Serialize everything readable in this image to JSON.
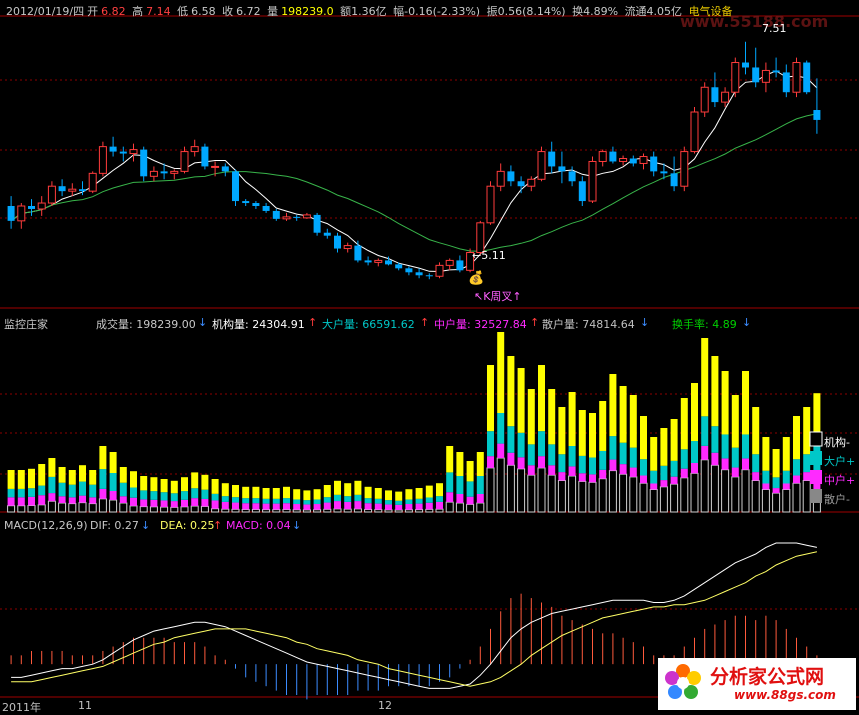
{
  "colors": {
    "up": "#ff3c3c",
    "down": "#00a8ff",
    "ma_short": "#ffffff",
    "ma_long": "#38b44a",
    "inst": "#ffffff",
    "big": "#00c8c8",
    "mid": "#ff2aff",
    "retail": "#ffff00",
    "dif": "#ffffff",
    "dea": "#ffff66",
    "hist_pos": "#ff5a3c",
    "hist_neg": "#3c8cff",
    "grid": "#8b0000"
  },
  "header": {
    "date": "2012/01/19/四",
    "open_label": "开",
    "open": "6.82",
    "high_label": "高",
    "high": "7.14",
    "low_label": "低",
    "low": "6.58",
    "close_label": "收",
    "close": "6.72",
    "vol_label": "量",
    "vol": "198239.0",
    "amount": "额1.36亿",
    "change": "幅-0.16(-2.33%)",
    "amplitude": "振0.56(8.14%)",
    "turnover": "换4.89%",
    "float": "流通4.05亿",
    "sector": "电气设备"
  },
  "price_annotations": {
    "high_mark": "7.51",
    "low_mark": "←5.11",
    "signal": "↖K周叉↑"
  },
  "volume_panel": {
    "title": "监控庄家",
    "vol_label": "成交量: 198239.00",
    "inst_label": "机构量: 24304.91",
    "big_label": "大户量: 66591.62",
    "mid_label": "中户量: 32527.84",
    "retail_label": "散户量: 74814.64",
    "turn_label": "换手率: 4.89",
    "legend": [
      "机构-",
      "大户+",
      "中户+",
      "散户-"
    ]
  },
  "macd_panel": {
    "title": "MACD(12,26,9)",
    "dif": "DIF: 0.27",
    "dea": "DEA: 0.25",
    "macd": "MACD: 0.04"
  },
  "x_axis": {
    "year": "2011年",
    "m1": "11",
    "m2": "12"
  },
  "watermark": {
    "site_ghost": "www.55188.com",
    "brand": "分析家公式网",
    "url": "www.88gs.com"
  },
  "chart_data": [
    {
      "type": "candlestick",
      "name": "price",
      "ohlc": [
        [
          5.85,
          5.95,
          5.62,
          5.7
        ],
        [
          5.7,
          5.88,
          5.62,
          5.85
        ],
        [
          5.85,
          5.92,
          5.75,
          5.82
        ],
        [
          5.82,
          5.95,
          5.75,
          5.88
        ],
        [
          5.88,
          6.1,
          5.85,
          6.05
        ],
        [
          6.05,
          6.12,
          5.95,
          6.0
        ],
        [
          6.0,
          6.08,
          5.95,
          6.02
        ],
        [
          6.02,
          6.1,
          5.96,
          6.0
        ],
        [
          6.0,
          6.2,
          5.98,
          6.18
        ],
        [
          6.18,
          6.5,
          6.15,
          6.45
        ],
        [
          6.45,
          6.55,
          6.35,
          6.4
        ],
        [
          6.4,
          6.45,
          6.3,
          6.38
        ],
        [
          6.38,
          6.48,
          6.3,
          6.42
        ],
        [
          6.42,
          6.45,
          6.1,
          6.15
        ],
        [
          6.15,
          6.25,
          6.1,
          6.2
        ],
        [
          6.2,
          6.28,
          6.12,
          6.18
        ],
        [
          6.18,
          6.22,
          6.12,
          6.2
        ],
        [
          6.2,
          6.45,
          6.18,
          6.4
        ],
        [
          6.4,
          6.52,
          6.35,
          6.45
        ],
        [
          6.45,
          6.48,
          6.22,
          6.25
        ],
        [
          6.25,
          6.3,
          6.15,
          6.25
        ],
        [
          6.25,
          6.28,
          6.15,
          6.2
        ],
        [
          6.2,
          6.22,
          5.85,
          5.9
        ],
        [
          5.9,
          5.92,
          5.85,
          5.88
        ],
        [
          5.88,
          5.9,
          5.82,
          5.85
        ],
        [
          5.85,
          5.88,
          5.78,
          5.8
        ],
        [
          5.8,
          5.82,
          5.7,
          5.72
        ],
        [
          5.72,
          5.78,
          5.7,
          5.74
        ],
        [
          5.74,
          5.76,
          5.7,
          5.73
        ],
        [
          5.73,
          5.78,
          5.72,
          5.76
        ],
        [
          5.76,
          5.78,
          5.55,
          5.58
        ],
        [
          5.58,
          5.62,
          5.52,
          5.55
        ],
        [
          5.55,
          5.58,
          5.38,
          5.42
        ],
        [
          5.42,
          5.48,
          5.38,
          5.45
        ],
        [
          5.45,
          5.5,
          5.28,
          5.3
        ],
        [
          5.3,
          5.34,
          5.25,
          5.28
        ],
        [
          5.28,
          5.32,
          5.24,
          5.3
        ],
        [
          5.3,
          5.34,
          5.25,
          5.26
        ],
        [
          5.26,
          5.28,
          5.2,
          5.22
        ],
        [
          5.22,
          5.24,
          5.15,
          5.18
        ],
        [
          5.18,
          5.22,
          5.12,
          5.15
        ],
        [
          5.15,
          5.17,
          5.11,
          5.14
        ],
        [
          5.14,
          5.28,
          5.12,
          5.25
        ],
        [
          5.25,
          5.32,
          5.2,
          5.3
        ],
        [
          5.3,
          5.35,
          5.18,
          5.2
        ],
        [
          5.2,
          5.42,
          5.18,
          5.38
        ],
        [
          5.38,
          5.7,
          5.36,
          5.68
        ],
        [
          5.68,
          6.1,
          5.66,
          6.05
        ],
        [
          6.05,
          6.28,
          6.0,
          6.2
        ],
        [
          6.2,
          6.26,
          6.05,
          6.1
        ],
        [
          6.1,
          6.15,
          5.98,
          6.05
        ],
        [
          6.05,
          6.15,
          6.0,
          6.12
        ],
        [
          6.12,
          6.45,
          6.1,
          6.4
        ],
        [
          6.4,
          6.5,
          6.18,
          6.25
        ],
        [
          6.25,
          6.4,
          6.08,
          6.2
        ],
        [
          6.2,
          6.25,
          6.05,
          6.1
        ],
        [
          6.1,
          6.15,
          5.85,
          5.9
        ],
        [
          5.9,
          6.35,
          5.88,
          6.3
        ],
        [
          6.3,
          6.42,
          6.25,
          6.4
        ],
        [
          6.4,
          6.45,
          6.28,
          6.3
        ],
        [
          6.3,
          6.36,
          6.26,
          6.33
        ],
        [
          6.33,
          6.36,
          6.25,
          6.28
        ],
        [
          6.28,
          6.38,
          6.22,
          6.35
        ],
        [
          6.35,
          6.4,
          6.15,
          6.2
        ],
        [
          6.2,
          6.28,
          6.12,
          6.18
        ],
        [
          6.18,
          6.35,
          6.0,
          6.05
        ],
        [
          6.05,
          6.45,
          6.0,
          6.4
        ],
        [
          6.4,
          6.85,
          6.38,
          6.8
        ],
        [
          6.8,
          7.1,
          6.75,
          7.05
        ],
        [
          7.05,
          7.2,
          6.85,
          6.9
        ],
        [
          6.9,
          7.05,
          6.85,
          7.0
        ],
        [
          7.0,
          7.35,
          6.95,
          7.3
        ],
        [
          7.3,
          7.51,
          7.18,
          7.25
        ],
        [
          7.25,
          7.45,
          7.05,
          7.1
        ],
        [
          7.1,
          7.3,
          7.0,
          7.22
        ],
        [
          7.22,
          7.35,
          7.15,
          7.2
        ],
        [
          7.2,
          7.28,
          6.95,
          7.0
        ],
        [
          7.0,
          7.35,
          6.95,
          7.3
        ],
        [
          7.3,
          7.32,
          6.98,
          7.0
        ],
        [
          6.82,
          7.14,
          6.58,
          6.72
        ]
      ],
      "ylim": [
        4.9,
        7.75
      ]
    },
    {
      "type": "stacked-bar",
      "name": "volume_breakdown",
      "series": [
        {
          "name": "散户量"
        },
        {
          "name": "中户量"
        },
        {
          "name": "大户量"
        },
        {
          "name": "机构量"
        }
      ],
      "totals": [
        70,
        70,
        72,
        80,
        90,
        75,
        70,
        78,
        70,
        110,
        100,
        75,
        68,
        60,
        58,
        55,
        52,
        58,
        66,
        62,
        55,
        48,
        45,
        42,
        42,
        40,
        40,
        42,
        38,
        36,
        38,
        45,
        52,
        48,
        52,
        42,
        40,
        36,
        34,
        38,
        40,
        44,
        48,
        110,
        100,
        85,
        100,
        245,
        300,
        260,
        240,
        205,
        245,
        205,
        175,
        200,
        170,
        165,
        185,
        230,
        210,
        195,
        160,
        125,
        140,
        155,
        190,
        215,
        290,
        260,
        235,
        195,
        235,
        175,
        125,
        105,
        125,
        160,
        175,
        198
      ],
      "ratios": [
        [
          0.45,
          0.2,
          0.2,
          0.15
        ],
        [
          0.45,
          0.2,
          0.2,
          0.15
        ],
        [
          0.45,
          0.2,
          0.2,
          0.15
        ],
        [
          0.45,
          0.2,
          0.2,
          0.15
        ],
        [
          0.35,
          0.15,
          0.3,
          0.2
        ],
        [
          0.35,
          0.15,
          0.3,
          0.2
        ],
        [
          0.35,
          0.15,
          0.3,
          0.2
        ],
        [
          0.35,
          0.15,
          0.3,
          0.2
        ],
        [
          0.35,
          0.15,
          0.3,
          0.2
        ],
        [
          0.35,
          0.15,
          0.3,
          0.2
        ],
        [
          0.35,
          0.15,
          0.3,
          0.2
        ],
        [
          0.35,
          0.15,
          0.3,
          0.2
        ],
        [
          0.4,
          0.2,
          0.25,
          0.15
        ],
        [
          0.4,
          0.2,
          0.25,
          0.15
        ],
        [
          0.4,
          0.2,
          0.25,
          0.15
        ],
        [
          0.4,
          0.2,
          0.25,
          0.15
        ],
        [
          0.4,
          0.2,
          0.25,
          0.15
        ],
        [
          0.4,
          0.2,
          0.25,
          0.15
        ],
        [
          0.4,
          0.2,
          0.25,
          0.15
        ],
        [
          0.4,
          0.2,
          0.25,
          0.15
        ],
        [
          0.45,
          0.25,
          0.2,
          0.1
        ],
        [
          0.45,
          0.25,
          0.2,
          0.1
        ],
        [
          0.45,
          0.25,
          0.2,
          0.1
        ],
        [
          0.45,
          0.25,
          0.2,
          0.1
        ],
        [
          0.45,
          0.25,
          0.2,
          0.1
        ],
        [
          0.45,
          0.25,
          0.2,
          0.1
        ],
        [
          0.45,
          0.25,
          0.2,
          0.1
        ],
        [
          0.45,
          0.25,
          0.2,
          0.1
        ],
        [
          0.45,
          0.25,
          0.2,
          0.1
        ],
        [
          0.45,
          0.25,
          0.2,
          0.1
        ],
        [
          0.45,
          0.25,
          0.2,
          0.1
        ],
        [
          0.45,
          0.25,
          0.2,
          0.1
        ],
        [
          0.45,
          0.25,
          0.2,
          0.1
        ],
        [
          0.45,
          0.25,
          0.2,
          0.1
        ],
        [
          0.45,
          0.25,
          0.2,
          0.1
        ],
        [
          0.45,
          0.25,
          0.2,
          0.1
        ],
        [
          0.45,
          0.25,
          0.2,
          0.1
        ],
        [
          0.45,
          0.25,
          0.2,
          0.1
        ],
        [
          0.45,
          0.25,
          0.2,
          0.1
        ],
        [
          0.45,
          0.25,
          0.2,
          0.1
        ],
        [
          0.45,
          0.25,
          0.2,
          0.1
        ],
        [
          0.45,
          0.25,
          0.2,
          0.1
        ],
        [
          0.45,
          0.25,
          0.2,
          0.1
        ],
        [
          0.4,
          0.15,
          0.3,
          0.15
        ],
        [
          0.4,
          0.15,
          0.3,
          0.15
        ],
        [
          0.4,
          0.15,
          0.3,
          0.15
        ],
        [
          0.4,
          0.15,
          0.3,
          0.15
        ],
        [
          0.45,
          0.08,
          0.17,
          0.3
        ],
        [
          0.45,
          0.08,
          0.17,
          0.3
        ],
        [
          0.45,
          0.08,
          0.17,
          0.3
        ],
        [
          0.45,
          0.08,
          0.17,
          0.3
        ],
        [
          0.45,
          0.08,
          0.17,
          0.3
        ],
        [
          0.45,
          0.08,
          0.17,
          0.3
        ],
        [
          0.45,
          0.08,
          0.17,
          0.3
        ],
        [
          0.45,
          0.08,
          0.17,
          0.3
        ],
        [
          0.45,
          0.08,
          0.17,
          0.3
        ],
        [
          0.45,
          0.08,
          0.17,
          0.3
        ],
        [
          0.45,
          0.08,
          0.17,
          0.3
        ],
        [
          0.45,
          0.08,
          0.17,
          0.3
        ],
        [
          0.45,
          0.08,
          0.17,
          0.3
        ],
        [
          0.45,
          0.08,
          0.17,
          0.3
        ],
        [
          0.45,
          0.08,
          0.17,
          0.3
        ],
        [
          0.45,
          0.08,
          0.17,
          0.3
        ],
        [
          0.45,
          0.08,
          0.17,
          0.3
        ],
        [
          0.45,
          0.08,
          0.17,
          0.3
        ],
        [
          0.45,
          0.08,
          0.17,
          0.3
        ],
        [
          0.45,
          0.08,
          0.17,
          0.3
        ],
        [
          0.45,
          0.08,
          0.17,
          0.3
        ],
        [
          0.45,
          0.08,
          0.17,
          0.3
        ],
        [
          0.45,
          0.08,
          0.17,
          0.3
        ],
        [
          0.45,
          0.08,
          0.17,
          0.3
        ],
        [
          0.45,
          0.08,
          0.17,
          0.3
        ],
        [
          0.45,
          0.08,
          0.17,
          0.3
        ],
        [
          0.45,
          0.08,
          0.17,
          0.3
        ],
        [
          0.45,
          0.08,
          0.17,
          0.3
        ],
        [
          0.45,
          0.08,
          0.17,
          0.3
        ],
        [
          0.45,
          0.08,
          0.17,
          0.3
        ],
        [
          0.45,
          0.08,
          0.17,
          0.3
        ],
        [
          0.45,
          0.08,
          0.17,
          0.3
        ],
        [
          0.38,
          0.16,
          0.34,
          0.12
        ]
      ]
    },
    {
      "type": "line+bar",
      "name": "macd",
      "dif": [
        -0.06,
        -0.06,
        -0.05,
        -0.04,
        -0.03,
        -0.02,
        -0.02,
        -0.01,
        0.0,
        0.02,
        0.05,
        0.08,
        0.11,
        0.13,
        0.15,
        0.16,
        0.17,
        0.18,
        0.19,
        0.19,
        0.18,
        0.17,
        0.15,
        0.13,
        0.11,
        0.09,
        0.07,
        0.05,
        0.03,
        0.01,
        0.0,
        -0.01,
        -0.02,
        -0.03,
        -0.04,
        -0.05,
        -0.06,
        -0.07,
        -0.08,
        -0.09,
        -0.1,
        -0.11,
        -0.11,
        -0.11,
        -0.1,
        -0.09,
        -0.05,
        0.0,
        0.06,
        0.12,
        0.16,
        0.19,
        0.21,
        0.23,
        0.24,
        0.25,
        0.26,
        0.27,
        0.28,
        0.29,
        0.29,
        0.29,
        0.29,
        0.28,
        0.28,
        0.29,
        0.31,
        0.34,
        0.37,
        0.4,
        0.43,
        0.46,
        0.48,
        0.5,
        0.53,
        0.55,
        0.55,
        0.55,
        0.54,
        0.53
      ],
      "dea": [
        -0.08,
        -0.08,
        -0.08,
        -0.07,
        -0.06,
        -0.05,
        -0.04,
        -0.03,
        -0.02,
        -0.01,
        0.01,
        0.03,
        0.05,
        0.07,
        0.09,
        0.1,
        0.12,
        0.13,
        0.14,
        0.15,
        0.16,
        0.16,
        0.16,
        0.16,
        0.15,
        0.14,
        0.13,
        0.12,
        0.1,
        0.09,
        0.07,
        0.06,
        0.05,
        0.04,
        0.02,
        0.01,
        0.0,
        -0.02,
        -0.03,
        -0.04,
        -0.05,
        -0.06,
        -0.07,
        -0.08,
        -0.09,
        -0.1,
        -0.09,
        -0.08,
        -0.06,
        -0.03,
        0.0,
        0.04,
        0.07,
        0.1,
        0.13,
        0.15,
        0.17,
        0.19,
        0.21,
        0.22,
        0.23,
        0.24,
        0.25,
        0.26,
        0.26,
        0.27,
        0.27,
        0.28,
        0.29,
        0.31,
        0.33,
        0.35,
        0.37,
        0.4,
        0.42,
        0.45,
        0.47,
        0.49,
        0.5,
        0.51
      ],
      "ylim": [
        -0.14,
        0.6
      ]
    }
  ]
}
